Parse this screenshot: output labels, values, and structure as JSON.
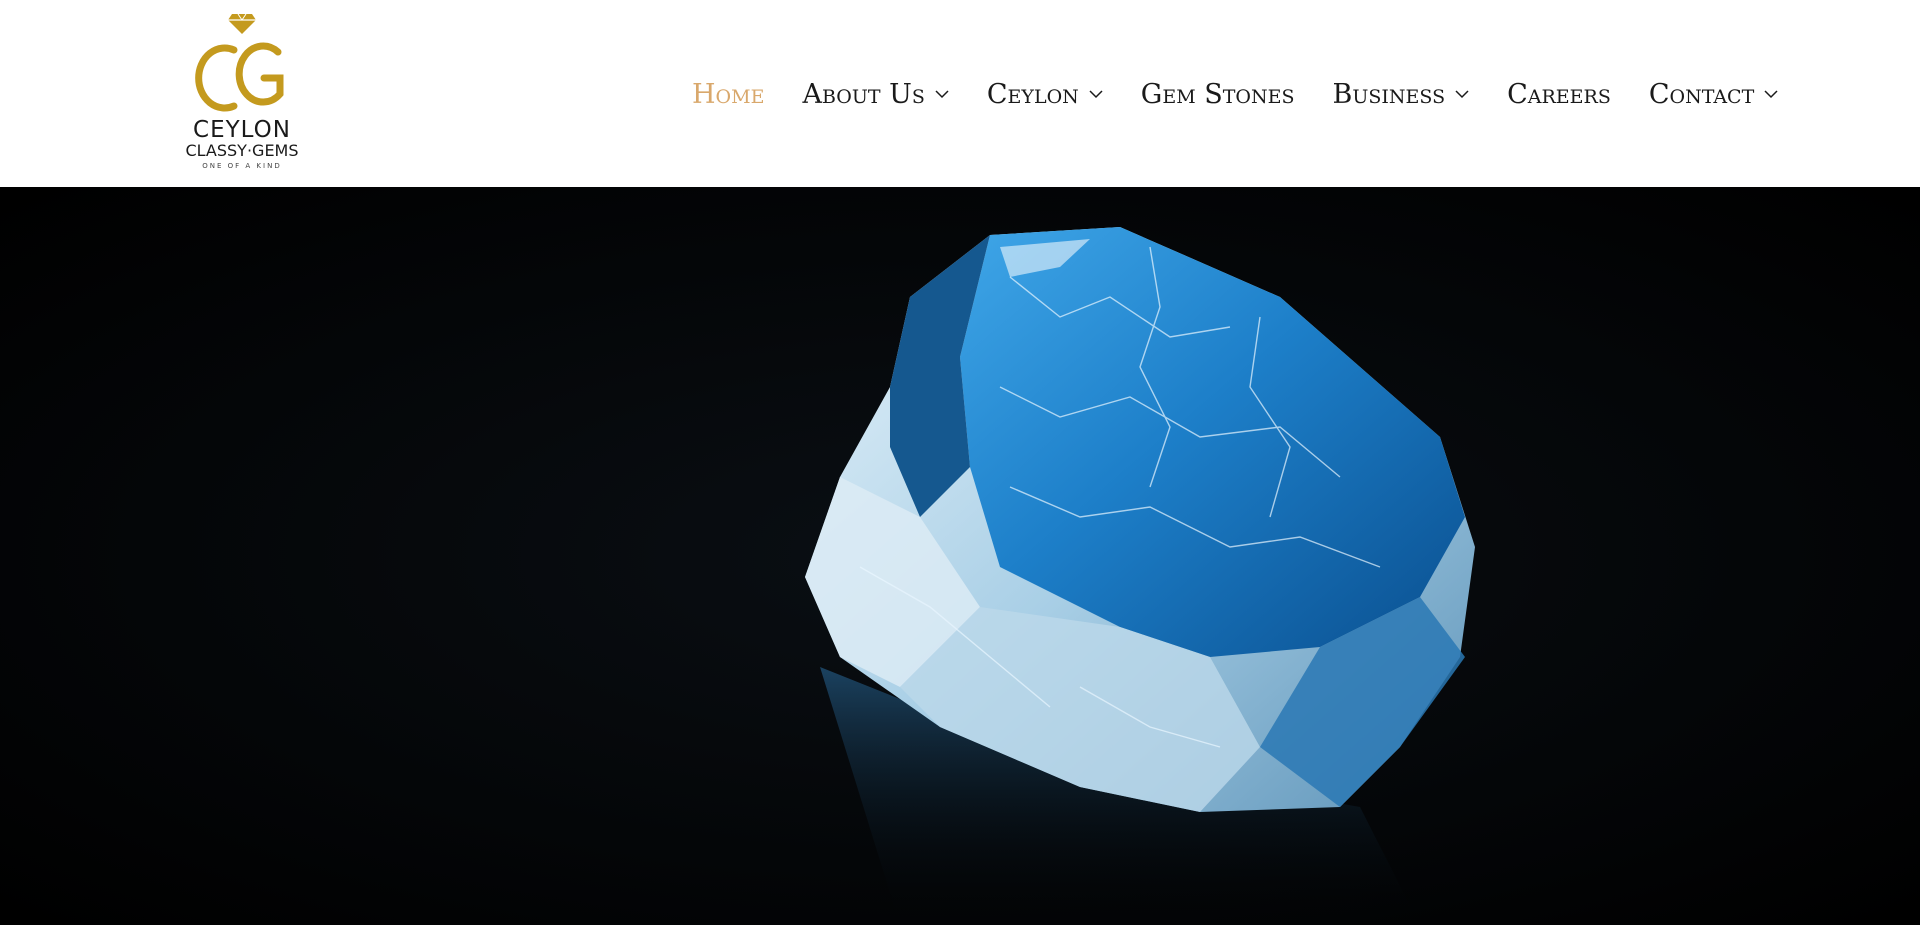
{
  "brand": {
    "line1": "CEYLON",
    "line2": "CLASSY·GEMS",
    "tagline": "ONE OF A KIND",
    "gold": "#c49a1e"
  },
  "nav": {
    "active_color": "#d9a86c",
    "items": [
      {
        "label": "Home",
        "dropdown": false,
        "active": true
      },
      {
        "label": "About Us",
        "dropdown": true,
        "active": false
      },
      {
        "label": "Ceylon",
        "dropdown": true,
        "active": false
      },
      {
        "label": "Gem Stones",
        "dropdown": false,
        "active": false
      },
      {
        "label": "Business",
        "dropdown": true,
        "active": false
      },
      {
        "label": "Careers",
        "dropdown": false,
        "active": false
      },
      {
        "label": "Contact",
        "dropdown": true,
        "active": false
      }
    ]
  },
  "hero": {
    "image": "rough-blue-gemstone-photo",
    "background": "#000000"
  }
}
